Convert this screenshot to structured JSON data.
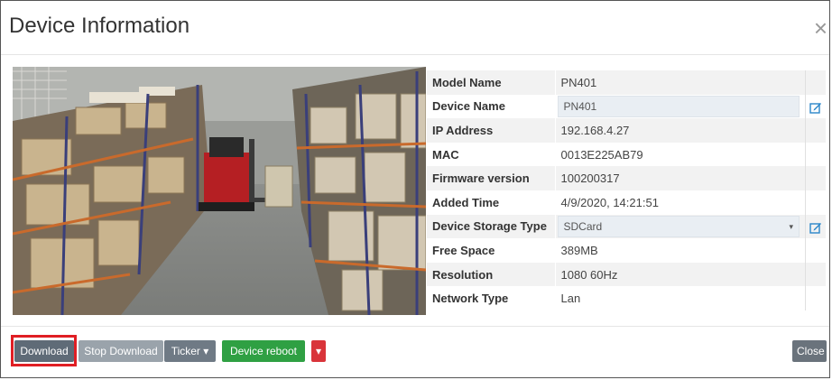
{
  "dialog": {
    "title": "Device Information",
    "close_glyph": "×"
  },
  "info_rows": [
    {
      "key": "Model Name",
      "value": "PN401",
      "editable": false
    },
    {
      "key": "Device Name",
      "value": "PN401",
      "editable": true
    },
    {
      "key": "IP Address",
      "value": "192.168.4.27",
      "editable": false
    },
    {
      "key": "MAC",
      "value": "0013E225AB79",
      "editable": false
    },
    {
      "key": "Firmware version",
      "value": "100200317",
      "editable": false
    },
    {
      "key": "Added Time",
      "value": "4/9/2020, 14:21:51",
      "editable": false
    },
    {
      "key": "Device Storage Type",
      "value": "SDCard",
      "editable": true
    },
    {
      "key": "Free Space",
      "value": "389MB",
      "editable": false
    },
    {
      "key": "Resolution",
      "value": "1080 60Hz",
      "editable": false
    },
    {
      "key": "Network Type",
      "value": "Lan",
      "editable": false
    }
  ],
  "buttons": {
    "download": "Download",
    "stop_download": "Stop Download",
    "ticker": "Ticker",
    "ticker_caret": "▾",
    "device_reboot": "Device reboot",
    "more_caret": "▾",
    "close": "Close"
  },
  "icons": {
    "edit": "edit-icon",
    "dropdown": "caret-down-icon"
  },
  "colors": {
    "download": "#5f6b77",
    "stop_download": "#9aa3ab",
    "reboot": "#2fa043",
    "danger": "#d9343a",
    "highlight": "#e01e24",
    "edit_icon": "#2a86c9"
  }
}
